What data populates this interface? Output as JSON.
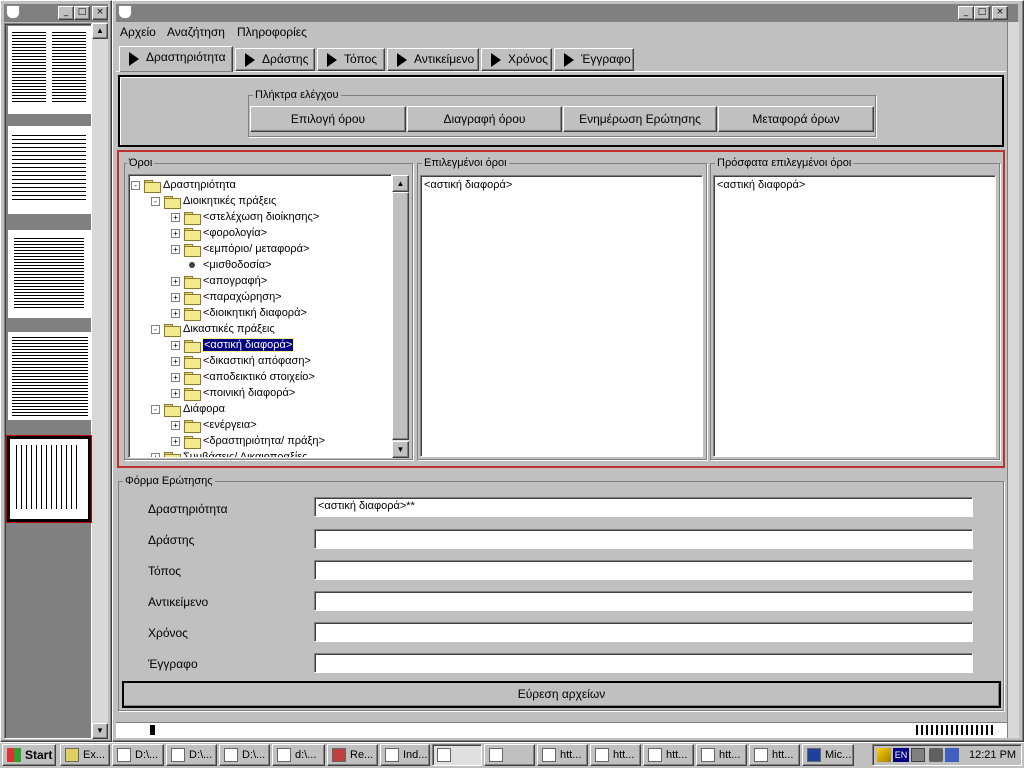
{
  "menu": [
    "Αρχείο",
    "Αναζήτηση",
    "Πληροφορίες"
  ],
  "tabs": [
    "Δραστηριότητα",
    "Δράστης",
    "Τόπος",
    "Αντικείμενο",
    "Χρόνος",
    "Έγγραφο"
  ],
  "control_keys": {
    "title": "Πλήκτρα ελέγχου",
    "buttons": [
      "Επιλογή όρου",
      "Διαγραφή όρου",
      "Ενημέρωση Ερώτησης",
      "Μεταφορά όρων"
    ]
  },
  "terms_panel": {
    "title": "Όροι",
    "tree": [
      {
        "label": "Δραστηριότητα",
        "level": 0,
        "expander": "-",
        "icon": "folder"
      },
      {
        "label": "Διοικητικές πράξεις",
        "level": 1,
        "expander": "-",
        "icon": "folder"
      },
      {
        "label": "<στελέχωση διοίκησης>",
        "level": 2,
        "expander": "+",
        "icon": "folder"
      },
      {
        "label": "<φορολογία>",
        "level": 2,
        "expander": "+",
        "icon": "folder"
      },
      {
        "label": "<εμπόριο/ μεταφορά>",
        "level": 2,
        "expander": "+",
        "icon": "folder"
      },
      {
        "label": "<μισθοδοσία>",
        "level": 2,
        "expander": "",
        "icon": "leaf"
      },
      {
        "label": "<απογραφή>",
        "level": 2,
        "expander": "+",
        "icon": "folder"
      },
      {
        "label": "<παραχώρηση>",
        "level": 2,
        "expander": "+",
        "icon": "folder"
      },
      {
        "label": "<διοικητική διαφορά>",
        "level": 2,
        "expander": "+",
        "icon": "folder"
      },
      {
        "label": "Δικαστικές πράξεις",
        "level": 1,
        "expander": "-",
        "icon": "folder"
      },
      {
        "label": "<αστική διαφορά>",
        "level": 2,
        "expander": "+",
        "icon": "folder",
        "selected": true
      },
      {
        "label": "<δικαστική απόφαση>",
        "level": 2,
        "expander": "+",
        "icon": "folder"
      },
      {
        "label": "<αποδεικτικό στοιχείο>",
        "level": 2,
        "expander": "+",
        "icon": "folder"
      },
      {
        "label": "<ποινική διαφορά>",
        "level": 2,
        "expander": "+",
        "icon": "folder"
      },
      {
        "label": "Διάφορα",
        "level": 1,
        "expander": "-",
        "icon": "folder"
      },
      {
        "label": "<ενέργεια>",
        "level": 2,
        "expander": "+",
        "icon": "folder"
      },
      {
        "label": "<δραστηριότητα/ πράξη>",
        "level": 2,
        "expander": "+",
        "icon": "folder"
      },
      {
        "label": "Συμβάσεις/ Δικαιοπραξίες",
        "level": 1,
        "expander": "+",
        "icon": "folder"
      }
    ]
  },
  "selected_terms": {
    "title": "Επιλεγμένοι όροι",
    "items": [
      "<αστική διαφορά>"
    ]
  },
  "recent_terms": {
    "title": "Πρόσφατα επιλεγμένοι όροι",
    "items": [
      "<αστική διαφορά>"
    ]
  },
  "query_form": {
    "title": "Φόρμα Ερώτησης",
    "fields": [
      {
        "label": "Δραστηριότητα",
        "value": "<αστική διαφορά>**"
      },
      {
        "label": "Δράστης",
        "value": ""
      },
      {
        "label": "Τόπος",
        "value": ""
      },
      {
        "label": "Αντικείμενο",
        "value": ""
      },
      {
        "label": "Χρόνος",
        "value": ""
      },
      {
        "label": "Έγγραφο",
        "value": ""
      }
    ],
    "search_button": "Εύρεση αρχείων"
  },
  "taskbar": {
    "start": "Start",
    "items": [
      "Ex...",
      "D:\\...",
      "D:\\...",
      "D:\\...",
      "d:\\...",
      "Re...",
      "Ind...",
      "",
      "",
      "htt...",
      "htt...",
      "htt...",
      "htt...",
      "htt...",
      "Mic..."
    ],
    "lang": "EN",
    "clock": "12:21 PM"
  },
  "colors": {
    "selection": "#000080",
    "accent_border": "#c00000",
    "titlebar": "#808080",
    "desktop": "#c0c0c0"
  }
}
